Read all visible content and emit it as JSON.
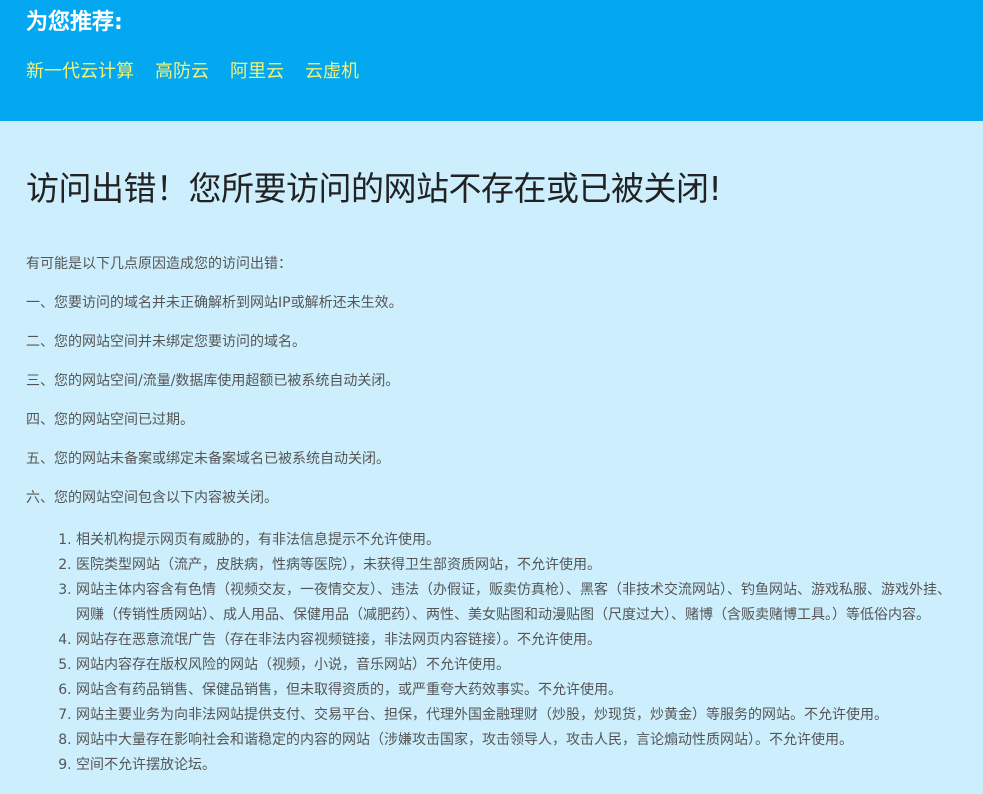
{
  "banner": {
    "title": "为您推荐:",
    "links": [
      "新一代云计算",
      "高防云",
      "阿里云",
      "云虚机"
    ]
  },
  "main": {
    "title": "访问出错！您所要访问的网站不存在或已被关闭!",
    "intro": "有可能是以下几点原因造成您的访问出错：",
    "reasons": [
      "一、您要访问的域名并未正确解析到网站IP或解析还未生效。",
      "二、您的网站空间并未绑定您要访问的域名。",
      "三、您的网站空间/流量/数据库使用超额已被系统自动关闭。",
      "四、您的网站空间已过期。",
      "五、您的网站未备案或绑定未备案域名已被系统自动关闭。",
      "六、您的网站空间包含以下内容被关闭。"
    ],
    "sub_items": [
      "相关机构提示网页有威胁的，有非法信息提示不允许使用。",
      "医院类型网站（流产，皮肤病，性病等医院），未获得卫生部资质网站，不允许使用。",
      "网站主体内容含有色情（视频交友，一夜情交友）、违法（办假证，贩卖仿真枪）、黑客（非技术交流网站）、钓鱼网站、游戏私服、游戏外挂、网赚（传销性质网站）、成人用品、保健用品（减肥药）、两性、美女贴图和动漫贴图（尺度过大）、赌博（含贩卖赌博工具。）等低俗内容。",
      "网站存在恶意流氓广告（存在非法内容视频链接，非法网页内容链接）。不允许使用。",
      "网站内容存在版权风险的网站（视频，小说，音乐网站）不允许使用。",
      "网站含有药品销售、保健品销售，但未取得资质的，或严重夸大药效事实。不允许使用。",
      "网站主要业务为向非法网站提供支付、交易平台、担保，代理外国金融理财（炒股，炒现货，炒黄金）等服务的网站。不允许使用。",
      "网站中大量存在影响社会和谐稳定的内容的网站（涉嫌攻击国家，攻击领导人，攻击人民，言论煽动性质网站）。不允许使用。",
      "空间不允许摆放论坛。"
    ]
  },
  "colors": {
    "banner_bg": "#03a8f0",
    "page_bg": "#cdeffd",
    "link": "#f2f27a"
  }
}
